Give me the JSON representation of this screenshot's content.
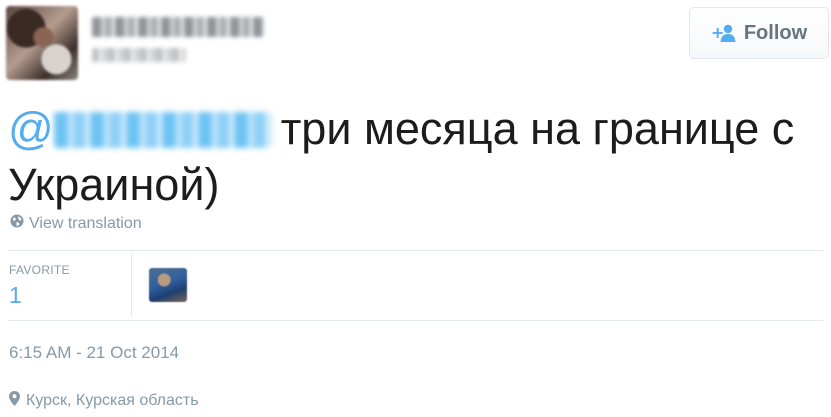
{
  "follow_button": {
    "label": "Follow",
    "icon": "add-user-icon"
  },
  "tweet": {
    "mention_prefix": "@",
    "text": "три месяца на границе с Украиной)"
  },
  "translate": {
    "label": "View translation",
    "icon": "globe-icon"
  },
  "stats": {
    "favorites_label": "FAVORITE",
    "favorites_count": "1"
  },
  "timestamp": "6:15 AM - 21 Oct 2014",
  "location": {
    "label": "Курск, Курская область",
    "icon": "map-pin-icon"
  },
  "colors": {
    "accent": "#55acee",
    "muted": "#8899a6",
    "text": "#1c1c1c",
    "divider": "#e1e8ed"
  }
}
